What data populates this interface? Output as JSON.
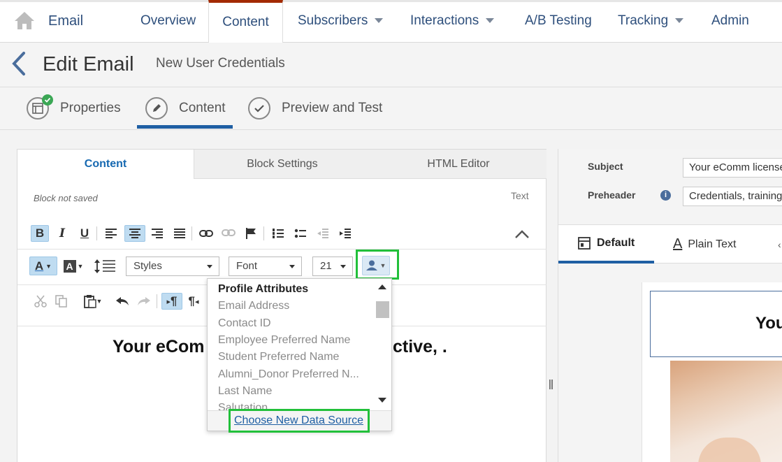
{
  "nav": {
    "home_icon": "home-icon",
    "app_title": "Email",
    "items": [
      {
        "label": "Overview"
      },
      {
        "label": "Content"
      },
      {
        "label": "Subscribers"
      },
      {
        "label": "Interactions"
      },
      {
        "label": "A/B Testing"
      },
      {
        "label": "Tracking"
      },
      {
        "label": "Admin"
      }
    ]
  },
  "header": {
    "title": "Edit Email",
    "subtitle": "New User Credentials"
  },
  "steps": [
    {
      "label": "Properties",
      "icon": "properties-icon"
    },
    {
      "label": "Content",
      "icon": "pencil-icon"
    },
    {
      "label": "Preview and Test",
      "icon": "checkmark-icon"
    }
  ],
  "editor": {
    "tabs": [
      "Content",
      "Block Settings",
      "HTML Editor"
    ],
    "status": "Block not saved",
    "block_type": "Text",
    "styles_select": "Styles",
    "font_select": "Font",
    "size_select": "21",
    "heading_left": "Your eCom",
    "heading_right": "ctive, ."
  },
  "attr_menu": {
    "header": "Profile Attributes",
    "items": [
      "Email Address",
      "Contact ID",
      "Employee Preferred Name",
      "Student Preferred Name",
      "Alumni_Donor Preferred N...",
      "Last Name",
      "Salutation"
    ],
    "footer_link": "Choose New Data Source"
  },
  "right": {
    "subject_label": "Subject",
    "subject_value": "Your eComm license",
    "preheader_label": "Preheader",
    "preheader_value": "Credentials, training",
    "tabs": [
      "Default",
      "Plain Text"
    ],
    "preview_heading": "You"
  },
  "colors": {
    "accent": "#1769b1",
    "nav_text": "#2e4f7c",
    "active_tab_border": "#a32a00",
    "highlight_box": "#22c03a"
  }
}
